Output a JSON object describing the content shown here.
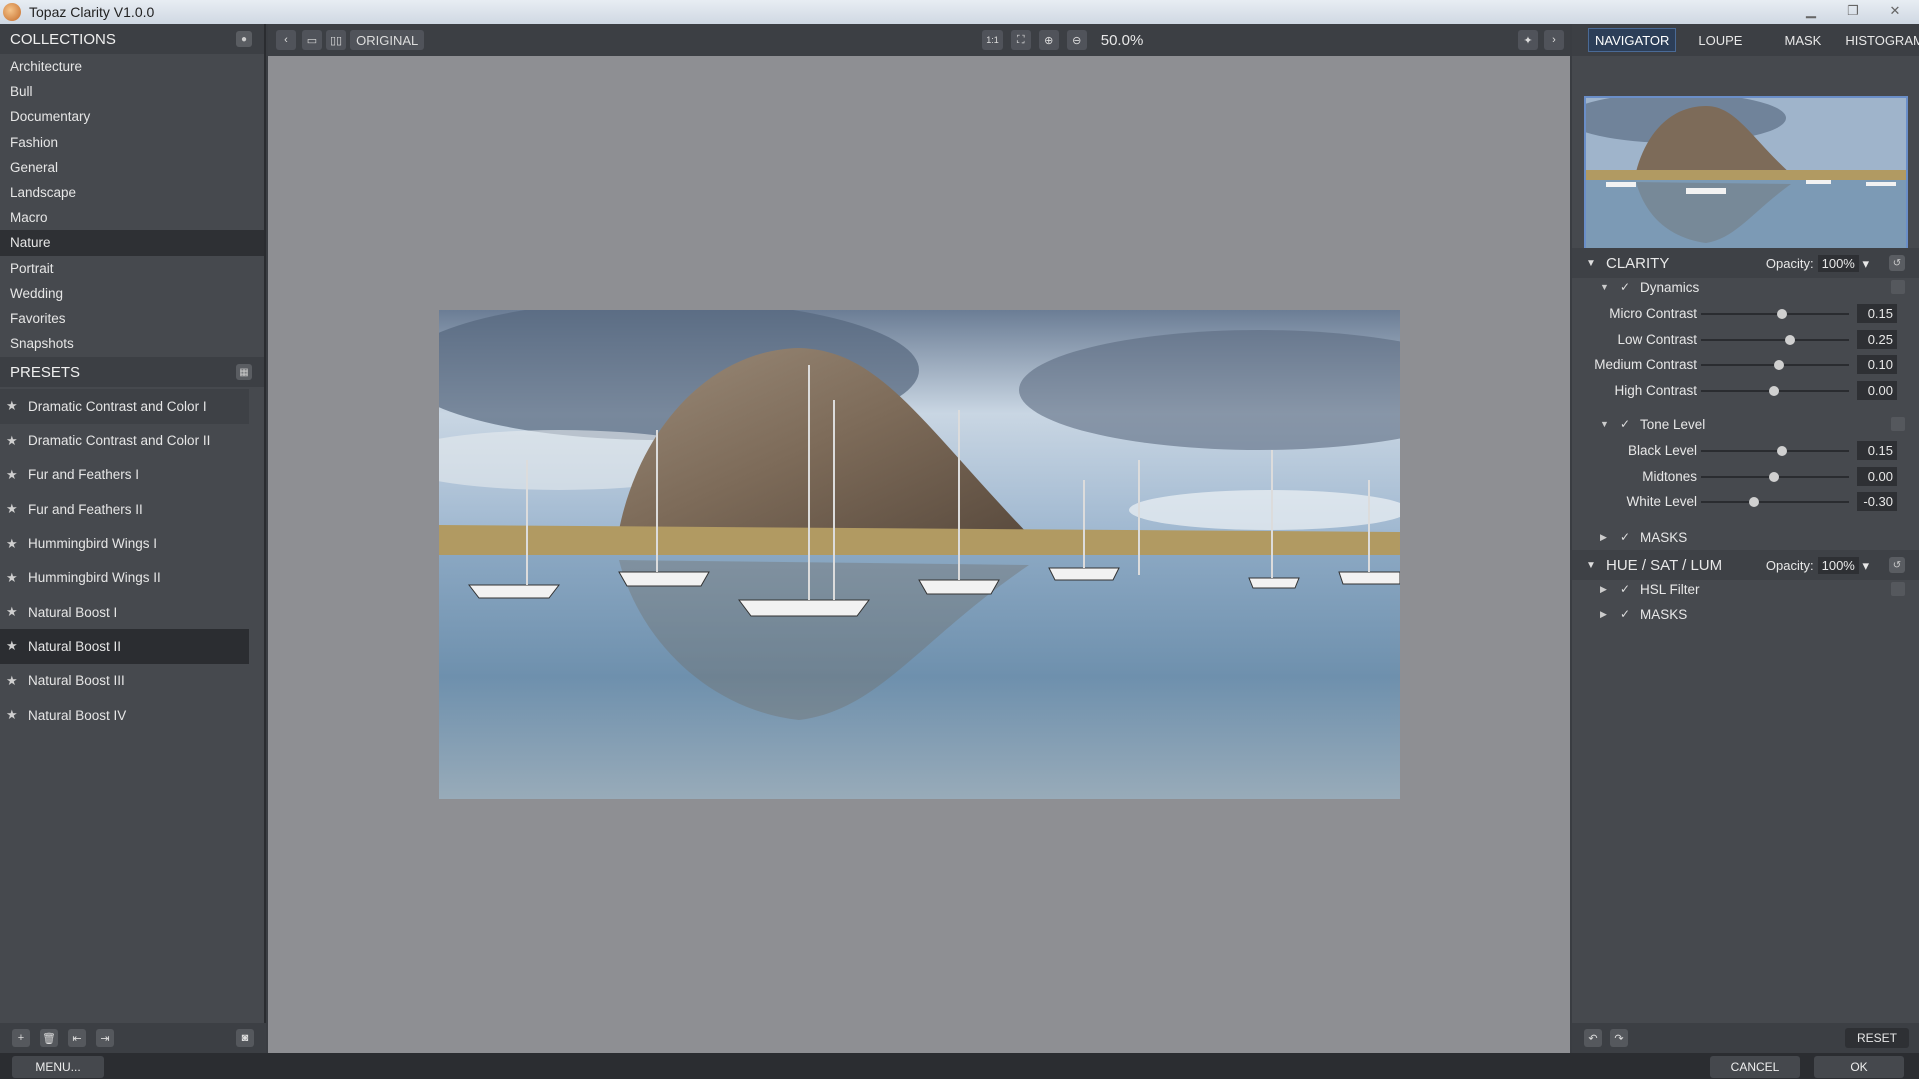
{
  "window": {
    "title": "Topaz Clarity V1.0.0",
    "minimize": "▁",
    "maximize": "❐",
    "close": "✕"
  },
  "collections": {
    "header": "COLLECTIONS",
    "items": [
      "Architecture",
      "Bull",
      "Documentary",
      "Fashion",
      "General",
      "Landscape",
      "Macro",
      "Nature",
      "Portrait",
      "Wedding",
      "Favorites",
      "Snapshots"
    ],
    "selected": "Nature"
  },
  "presets": {
    "header": "PRESETS",
    "items": [
      "Dramatic Contrast and Color I",
      "Dramatic Contrast and Color II",
      "Fur and Feathers I",
      "Fur and Feathers II",
      "Hummingbird Wings I",
      "Hummingbird Wings II",
      "Natural Boost I",
      "Natural Boost II",
      "Natural Boost III",
      "Natural Boost IV"
    ],
    "selected": "Natural Boost II"
  },
  "toolbar": {
    "original_label": "ORIGINAL",
    "zoom_1to1": "1:1",
    "zoom_level": "50.0%"
  },
  "right_tabs": [
    "NAVIGATOR",
    "LOUPE",
    "MASK",
    "HISTOGRAM"
  ],
  "active_tab": "NAVIGATOR",
  "clarity": {
    "label": "CLARITY",
    "opacity_label": "Opacity:",
    "opacity_value": "100%",
    "dynamics": {
      "label": "Dynamics",
      "sliders": [
        {
          "label": "Micro Contrast",
          "value": "0.15",
          "pos": 0.55
        },
        {
          "label": "Low Contrast",
          "value": "0.25",
          "pos": 0.6
        },
        {
          "label": "Medium Contrast",
          "value": "0.10",
          "pos": 0.53
        },
        {
          "label": "High Contrast",
          "value": "0.00",
          "pos": 0.49
        }
      ]
    },
    "tone_level": {
      "label": "Tone Level",
      "sliders": [
        {
          "label": "Black Level",
          "value": "0.15",
          "pos": 0.55
        },
        {
          "label": "Midtones",
          "value": "0.00",
          "pos": 0.49
        },
        {
          "label": "White Level",
          "value": "-0.30",
          "pos": 0.36
        }
      ]
    },
    "masks_label": "MASKS"
  },
  "hsl": {
    "label": "HUE / SAT / LUM",
    "opacity_label": "Opacity:",
    "opacity_value": "100%",
    "filter_label": "HSL Filter",
    "masks_label": "MASKS"
  },
  "footer": {
    "reset": "RESET",
    "menu": "MENU...",
    "cancel": "CANCEL",
    "ok": "OK"
  },
  "colors": {
    "panel": "#46494e",
    "canvas_bg": "#8e8f93",
    "selection": "#2c3e58"
  }
}
